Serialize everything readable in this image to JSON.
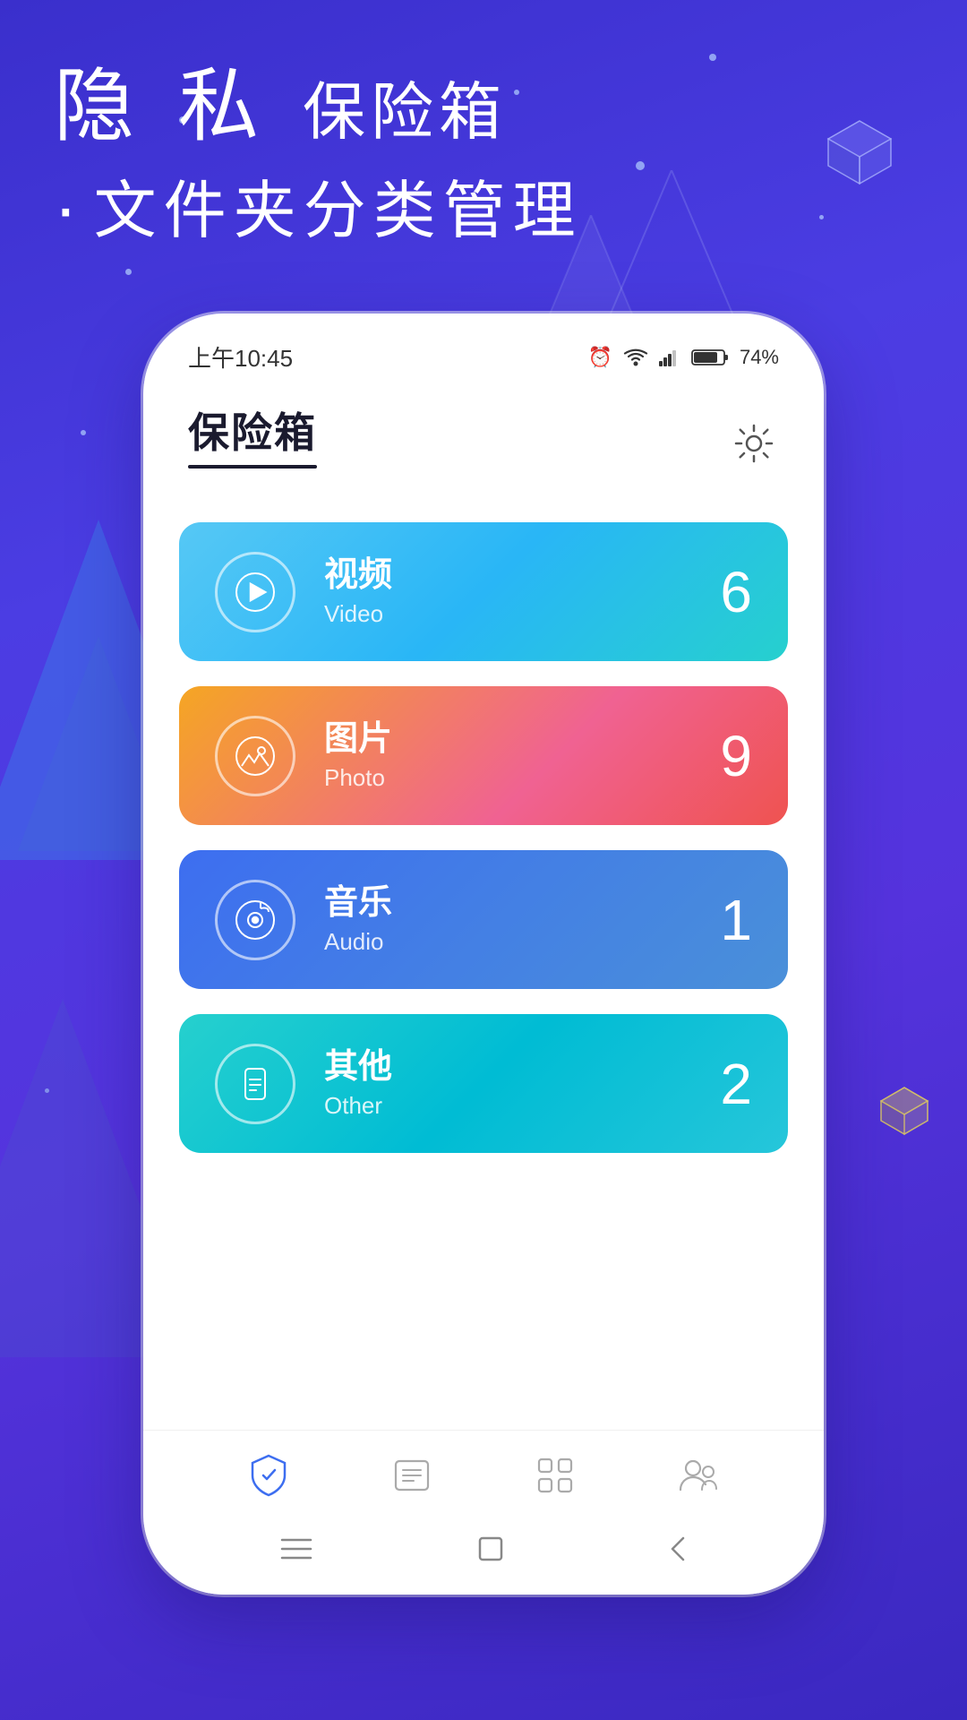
{
  "background": {
    "gradient_start": "#3a2fcc",
    "gradient_end": "#3a28c0"
  },
  "header": {
    "line1_char1": "隐",
    "line1_char2": "私",
    "line1_suffix": "保险箱",
    "line2": "文件夹分类管理"
  },
  "status_bar": {
    "time": "上午10:45",
    "battery": "74%"
  },
  "app": {
    "title": "保险箱",
    "settings_label": "设置"
  },
  "categories": [
    {
      "name_cn": "视频",
      "name_en": "Video",
      "count": "6",
      "color_class": "card-video",
      "icon_type": "video"
    },
    {
      "name_cn": "图片",
      "name_en": "Photo",
      "count": "9",
      "color_class": "card-photo",
      "icon_type": "photo"
    },
    {
      "name_cn": "音乐",
      "name_en": "Audio",
      "count": "1",
      "color_class": "card-audio",
      "icon_type": "audio"
    },
    {
      "name_cn": "其他",
      "name_en": "Other",
      "count": "2",
      "color_class": "card-other",
      "icon_type": "other"
    }
  ],
  "bottom_nav": [
    {
      "icon": "shield",
      "active": true,
      "label": "保险箱"
    },
    {
      "icon": "list",
      "active": false,
      "label": "列表"
    },
    {
      "icon": "apps",
      "active": false,
      "label": "应用"
    },
    {
      "icon": "people",
      "active": false,
      "label": "用户"
    }
  ],
  "system_nav": [
    {
      "icon": "menu",
      "label": "菜单"
    },
    {
      "icon": "square",
      "label": "主页"
    },
    {
      "icon": "back",
      "label": "返回"
    }
  ]
}
